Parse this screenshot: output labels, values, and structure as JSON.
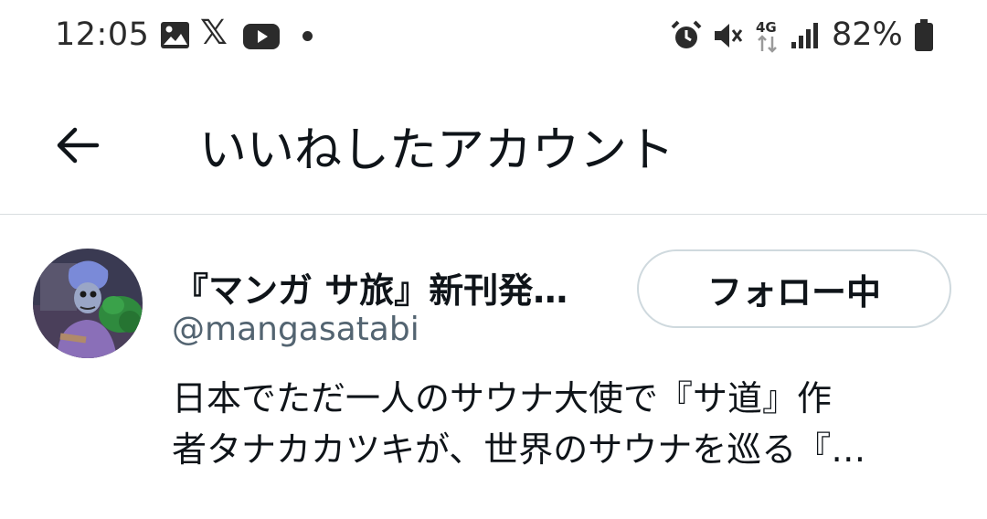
{
  "status_bar": {
    "time": "12:05",
    "notification_icons": [
      "image-icon",
      "x-logo-icon",
      "youtube-icon",
      "dot-icon"
    ],
    "x_glyph": "𝕏",
    "system_icons": [
      "alarm-icon",
      "vibrate-mute-icon",
      "4g-icon",
      "signal-icon",
      "battery-icon"
    ],
    "network_label": "4G",
    "battery": "82%"
  },
  "header": {
    "back_icon": "arrow-left-icon",
    "title": "いいねしたアカウント"
  },
  "account": {
    "display_name": "『マンガ サ旅』新刊発…",
    "handle": "@mangasatabi",
    "follow_label": "フォロー中",
    "bio_line1": "日本でただ一人のサウナ大使で『サ道』作",
    "bio_line2": "者タナカカツキが、世界のサウナを巡る『…"
  },
  "colors": {
    "text_primary": "#0f1419",
    "text_secondary": "#536471",
    "border": "#cfd9de",
    "status_icon": "#2b2b2b"
  }
}
